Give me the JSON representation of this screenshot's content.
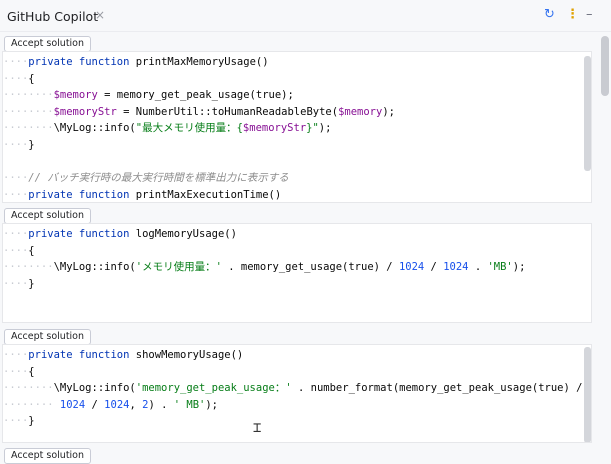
{
  "header": {
    "title": "GitHub Copilot",
    "close_glyph": "×",
    "icons": {
      "refresh": "refresh-icon",
      "more": "more-vertical-icon",
      "minimize": "minimize-icon"
    }
  },
  "accept_label": "Accept solution",
  "solutions": [
    {
      "lines": [
        {
          "indent": 1,
          "tokens": [
            {
              "t": "private ",
              "c": "kw"
            },
            {
              "t": "function ",
              "c": "kw"
            },
            {
              "t": "printMaxMemoryUsage()",
              "c": "fn"
            }
          ]
        },
        {
          "indent": 1,
          "tokens": [
            {
              "t": "{",
              "c": "fn"
            }
          ]
        },
        {
          "indent": 2,
          "tokens": [
            {
              "t": "$memory",
              "c": "var"
            },
            {
              "t": " = memory_get_peak_usage(true);",
              "c": "fn"
            }
          ]
        },
        {
          "indent": 2,
          "tokens": [
            {
              "t": "$memoryStr",
              "c": "var"
            },
            {
              "t": " = NumberUtil::toHumanReadableByte(",
              "c": "fn"
            },
            {
              "t": "$memory",
              "c": "var"
            },
            {
              "t": ");",
              "c": "fn"
            }
          ]
        },
        {
          "indent": 2,
          "tokens": [
            {
              "t": "\\MyLog::info(",
              "c": "fn"
            },
            {
              "t": "\"最大メモリ使用量：{",
              "c": "str"
            },
            {
              "t": "$memoryStr",
              "c": "var"
            },
            {
              "t": "}\"",
              "c": "str"
            },
            {
              "t": ");",
              "c": "fn"
            }
          ]
        },
        {
          "indent": 1,
          "tokens": [
            {
              "t": "}",
              "c": "fn"
            }
          ]
        },
        {
          "indent": 0,
          "tokens": []
        },
        {
          "indent": 1,
          "tokens": [
            {
              "t": "// バッチ実行時の最大実行時間を標準出力に表示する",
              "c": "cmt"
            }
          ]
        },
        {
          "indent": 1,
          "tokens": [
            {
              "t": "private ",
              "c": "kw"
            },
            {
              "t": "function ",
              "c": "kw"
            },
            {
              "t": "printMaxExecutionTime()",
              "c": "fn"
            }
          ]
        }
      ]
    },
    {
      "lines": [
        {
          "indent": 1,
          "tokens": [
            {
              "t": "private ",
              "c": "kw"
            },
            {
              "t": "function ",
              "c": "kw"
            },
            {
              "t": "logMemoryUsage()",
              "c": "fn"
            }
          ]
        },
        {
          "indent": 1,
          "tokens": [
            {
              "t": "{",
              "c": "fn"
            }
          ]
        },
        {
          "indent": 2,
          "tokens": [
            {
              "t": "\\MyLog::info(",
              "c": "fn"
            },
            {
              "t": "'メモリ使用量：'",
              "c": "str"
            },
            {
              "t": " . memory_get_usage(true) / ",
              "c": "fn"
            },
            {
              "t": "1024",
              "c": "num"
            },
            {
              "t": " / ",
              "c": "fn"
            },
            {
              "t": "1024",
              "c": "num"
            },
            {
              "t": " . ",
              "c": "fn"
            },
            {
              "t": "'MB'",
              "c": "str"
            },
            {
              "t": ");",
              "c": "fn"
            }
          ]
        },
        {
          "indent": 1,
          "tokens": [
            {
              "t": "}",
              "c": "fn"
            }
          ]
        }
      ]
    },
    {
      "lines": [
        {
          "indent": 1,
          "tokens": [
            {
              "t": "private ",
              "c": "kw"
            },
            {
              "t": "function ",
              "c": "kw"
            },
            {
              "t": "showMemoryUsage()",
              "c": "fn"
            }
          ]
        },
        {
          "indent": 1,
          "tokens": [
            {
              "t": "{",
              "c": "fn"
            }
          ]
        },
        {
          "indent": 2,
          "tokens": [
            {
              "t": "\\MyLog::info(",
              "c": "fn"
            },
            {
              "t": "'memory_get_peak_usage：'",
              "c": "str"
            },
            {
              "t": " . number_format(memory_get_peak_usage(true) /",
              "c": "fn"
            }
          ]
        },
        {
          "indent": 2,
          "tokens": [
            {
              "t": " ",
              "c": "fn"
            },
            {
              "t": "1024",
              "c": "num"
            },
            {
              "t": " / ",
              "c": "fn"
            },
            {
              "t": "1024",
              "c": "num"
            },
            {
              "t": ", ",
              "c": "fn"
            },
            {
              "t": "2",
              "c": "num"
            },
            {
              "t": ") . ",
              "c": "fn"
            },
            {
              "t": "' MB'",
              "c": "str"
            },
            {
              "t": ");",
              "c": "fn"
            }
          ]
        },
        {
          "indent": 1,
          "tokens": [
            {
              "t": "}",
              "c": "fn"
            }
          ]
        }
      ]
    },
    {
      "lines": []
    }
  ]
}
